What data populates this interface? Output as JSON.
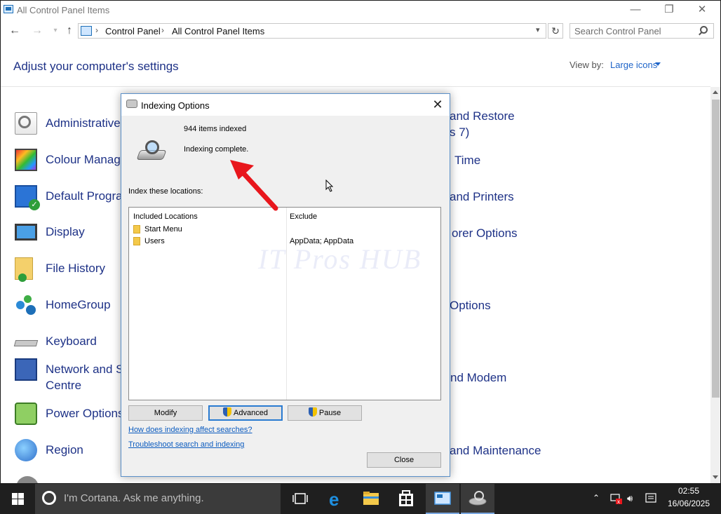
{
  "window": {
    "title": "All Control Panel Items",
    "controls": {
      "minimize": "—",
      "maximize": "❐",
      "close": "✕"
    }
  },
  "nav": {
    "back": "←",
    "forward": "→",
    "up": "↑",
    "breadcrumbs": [
      "Control Panel",
      "All Control Panel Items"
    ],
    "refresh": "↻",
    "search_placeholder": "Search Control Panel"
  },
  "header": {
    "title": "Adjust your computer's settings",
    "view_by_label": "View by:",
    "view_by_value": "Large icons"
  },
  "left_items": [
    {
      "label": "Administrative",
      "icon": "administrative-tools-icon"
    },
    {
      "label": "Colour Manage",
      "icon": "colour-management-icon"
    },
    {
      "label": "Default Progra",
      "icon": "default-programs-icon"
    },
    {
      "label": "Display",
      "icon": "display-icon"
    },
    {
      "label": "File History",
      "icon": "file-history-icon"
    },
    {
      "label": "HomeGroup",
      "icon": "homegroup-icon"
    },
    {
      "label": "Keyboard",
      "icon": "keyboard-icon"
    },
    {
      "label": "Network and S",
      "label2": "Centre",
      "icon": "network-icon"
    },
    {
      "label": "Power Options",
      "icon": "power-options-icon"
    },
    {
      "label": "Region",
      "icon": "region-icon"
    }
  ],
  "right_items": [
    {
      "label": "and Restore",
      "label2": "s 7)"
    },
    {
      "label": "Time"
    },
    {
      "label": "and Printers"
    },
    {
      "label": "orer Options"
    },
    {
      "label": "Options"
    },
    {
      "label": "nd Modem"
    },
    {
      "label": "and Maintenance"
    }
  ],
  "dialog": {
    "title": "Indexing Options",
    "items_indexed": "944 items indexed",
    "status": "Indexing complete.",
    "locations_label": "Index these locations:",
    "columns": {
      "included": "Included Locations",
      "exclude": "Exclude"
    },
    "locations": [
      {
        "name": "Start Menu",
        "exclude": ""
      },
      {
        "name": "Users",
        "exclude": "AppData; AppData"
      }
    ],
    "buttons": {
      "modify": "Modify",
      "advanced": "Advanced",
      "pause": "Pause",
      "close": "Close"
    },
    "links": {
      "affect": "How does indexing affect searches?",
      "troubleshoot": "Troubleshoot search and indexing"
    }
  },
  "watermark": "IT Pros HUB",
  "taskbar": {
    "cortana_text": "I'm Cortana. Ask me anything.",
    "time": "02:55",
    "date": "16/06/2025"
  },
  "colors": {
    "link_blue": "#1e3287",
    "accent": "#0b5bbf",
    "annotation_arrow": "#e8161c"
  }
}
